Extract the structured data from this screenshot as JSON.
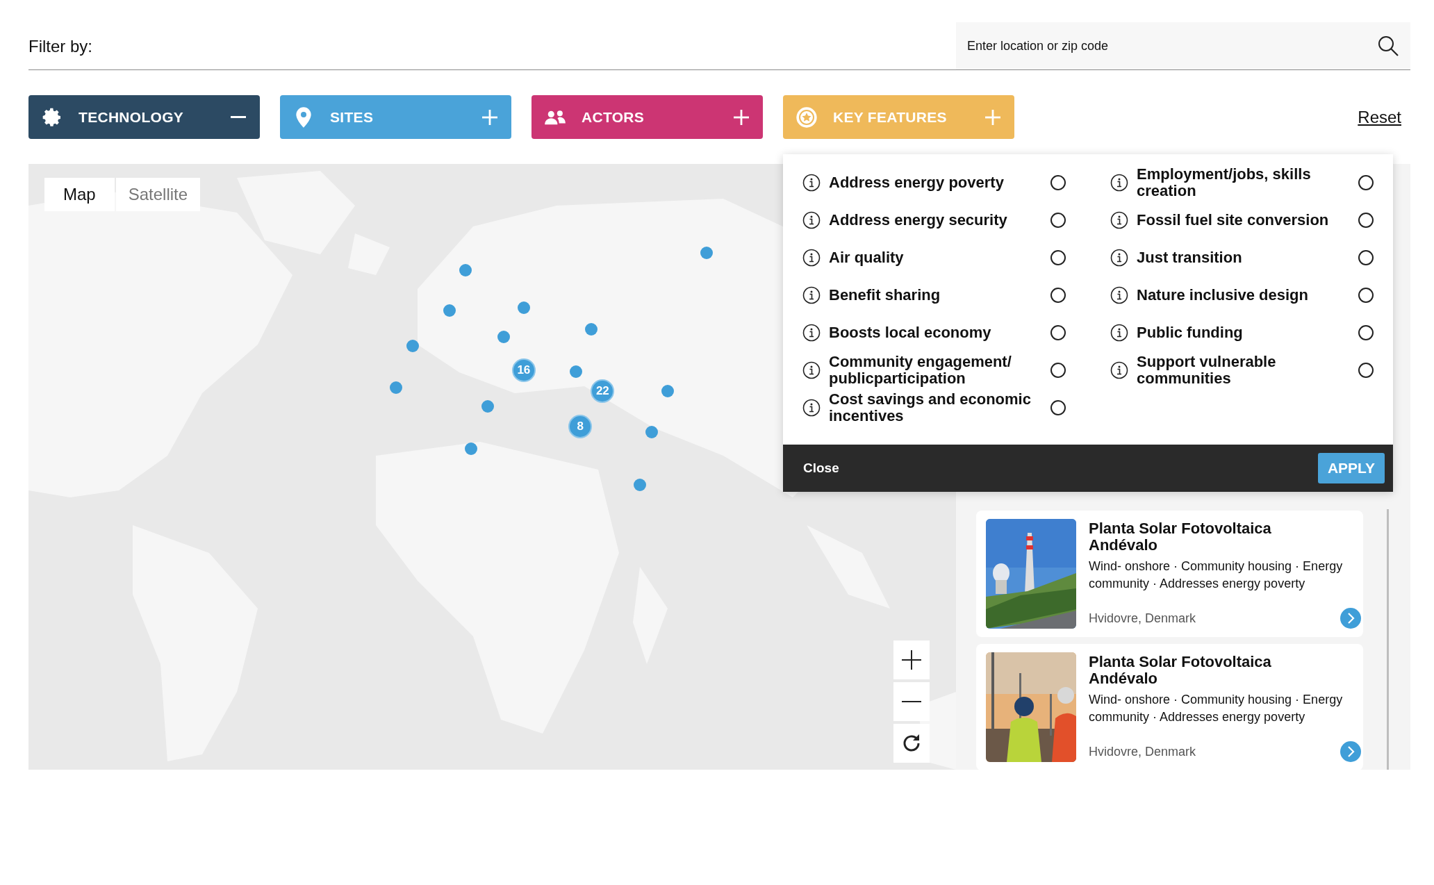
{
  "header": {
    "label": "Filter by:",
    "search": {
      "placeholder": "Enter location or zip code"
    }
  },
  "filters": [
    {
      "kind": "gear",
      "label": "TECHNOLOGY",
      "expanded": true,
      "color": "#2c4a63"
    },
    {
      "kind": "pin",
      "label": "SITES",
      "expanded": false,
      "color": "#4aa3d9"
    },
    {
      "kind": "people",
      "label": "ACTORS",
      "expanded": false,
      "color": "#cc3573"
    },
    {
      "kind": "star",
      "label": "KEY FEATURES",
      "expanded": false,
      "color": "#efb95a"
    }
  ],
  "reset": "Reset",
  "map": {
    "tabs": [
      {
        "label": "Map",
        "selected": true
      },
      {
        "label": "Satellite",
        "selected": false
      }
    ],
    "clusters": [
      "16",
      "22",
      "8"
    ]
  },
  "features_panel": {
    "columns": [
      [
        {
          "label": "Address energy poverty",
          "checked": false
        },
        {
          "label": "Address energy security",
          "checked": false
        },
        {
          "label": "Air quality",
          "checked": false
        },
        {
          "label": "Benefit sharing",
          "checked": false
        },
        {
          "label": "Boosts local economy",
          "checked": false
        },
        {
          "label": "Community engagement/ publicparticipation",
          "checked": false
        },
        {
          "label": "Cost savings and economic incentives",
          "checked": false
        }
      ],
      [
        {
          "label": "Employment/jobs, skills creation",
          "checked": false
        },
        {
          "label": "Fossil fuel site conversion",
          "checked": false
        },
        {
          "label": "Just transition",
          "checked": false
        },
        {
          "label": "Nature inclusive design",
          "checked": false
        },
        {
          "label": "Public funding",
          "checked": false
        },
        {
          "label": "Support vulnerable communities",
          "checked": false
        }
      ]
    ],
    "close": "Close",
    "apply": "APPLY"
  },
  "results": [
    {
      "title": "Planta Solar Fotovoltaica Andévalo",
      "tags": "Wind- onshore · Community housing · Energy community · Addresses energy poverty",
      "location": "Hvidovre, Denmark"
    },
    {
      "title": "Planta Solar Fotovoltaica Andévalo",
      "tags": "Wind- onshore · Community housing · Energy community · Addresses energy poverty",
      "location": "Hvidovre, Denmark"
    }
  ]
}
